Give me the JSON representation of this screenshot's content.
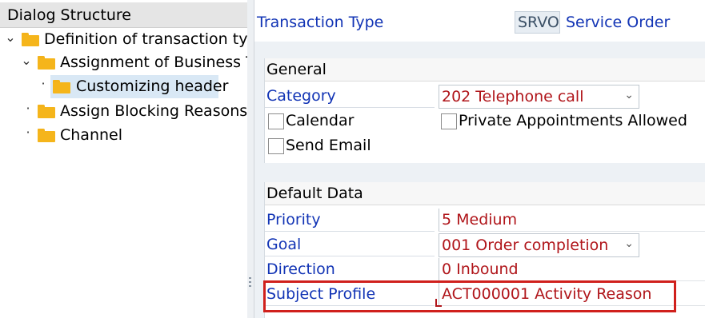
{
  "left_pane": {
    "header": "Dialog Structure",
    "tree": [
      {
        "label": "Definition of transaction type",
        "expanded": true,
        "level": 0
      },
      {
        "label": "Assignment of Business Tr",
        "expanded": true,
        "level": 1
      },
      {
        "label": "Customizing header",
        "selected": true,
        "level": 2
      },
      {
        "label": "Assign Blocking Reasons",
        "level": 1
      },
      {
        "label": "Channel",
        "level": 1
      }
    ]
  },
  "right_pane": {
    "transaction_type_label": "Transaction Type",
    "transaction_type_code": "SRVO",
    "transaction_type_desc": "Service Order",
    "general": {
      "title": "General",
      "category_label": "Category",
      "category_value": "202 Telephone call",
      "calendar_label": "Calendar",
      "calendar_checked": false,
      "private_label": "Private Appointments Allowed",
      "private_checked": false,
      "send_email_label": "Send Email",
      "send_email_checked": false
    },
    "default_data": {
      "title": "Default Data",
      "priority_label": "Priority",
      "priority_value": "5 Medium",
      "goal_label": "Goal",
      "goal_value": "001 Order completion",
      "direction_label": "Direction",
      "direction_value": "0 Inbound",
      "subject_profile_label": "Subject Profile",
      "subject_profile_value": "ACT000001 Activity Reason"
    }
  },
  "colors": {
    "label_blue": "#1234b5",
    "value_red": "#b0151a",
    "folder": "#f5b51b",
    "highlight": "#d0201c"
  }
}
